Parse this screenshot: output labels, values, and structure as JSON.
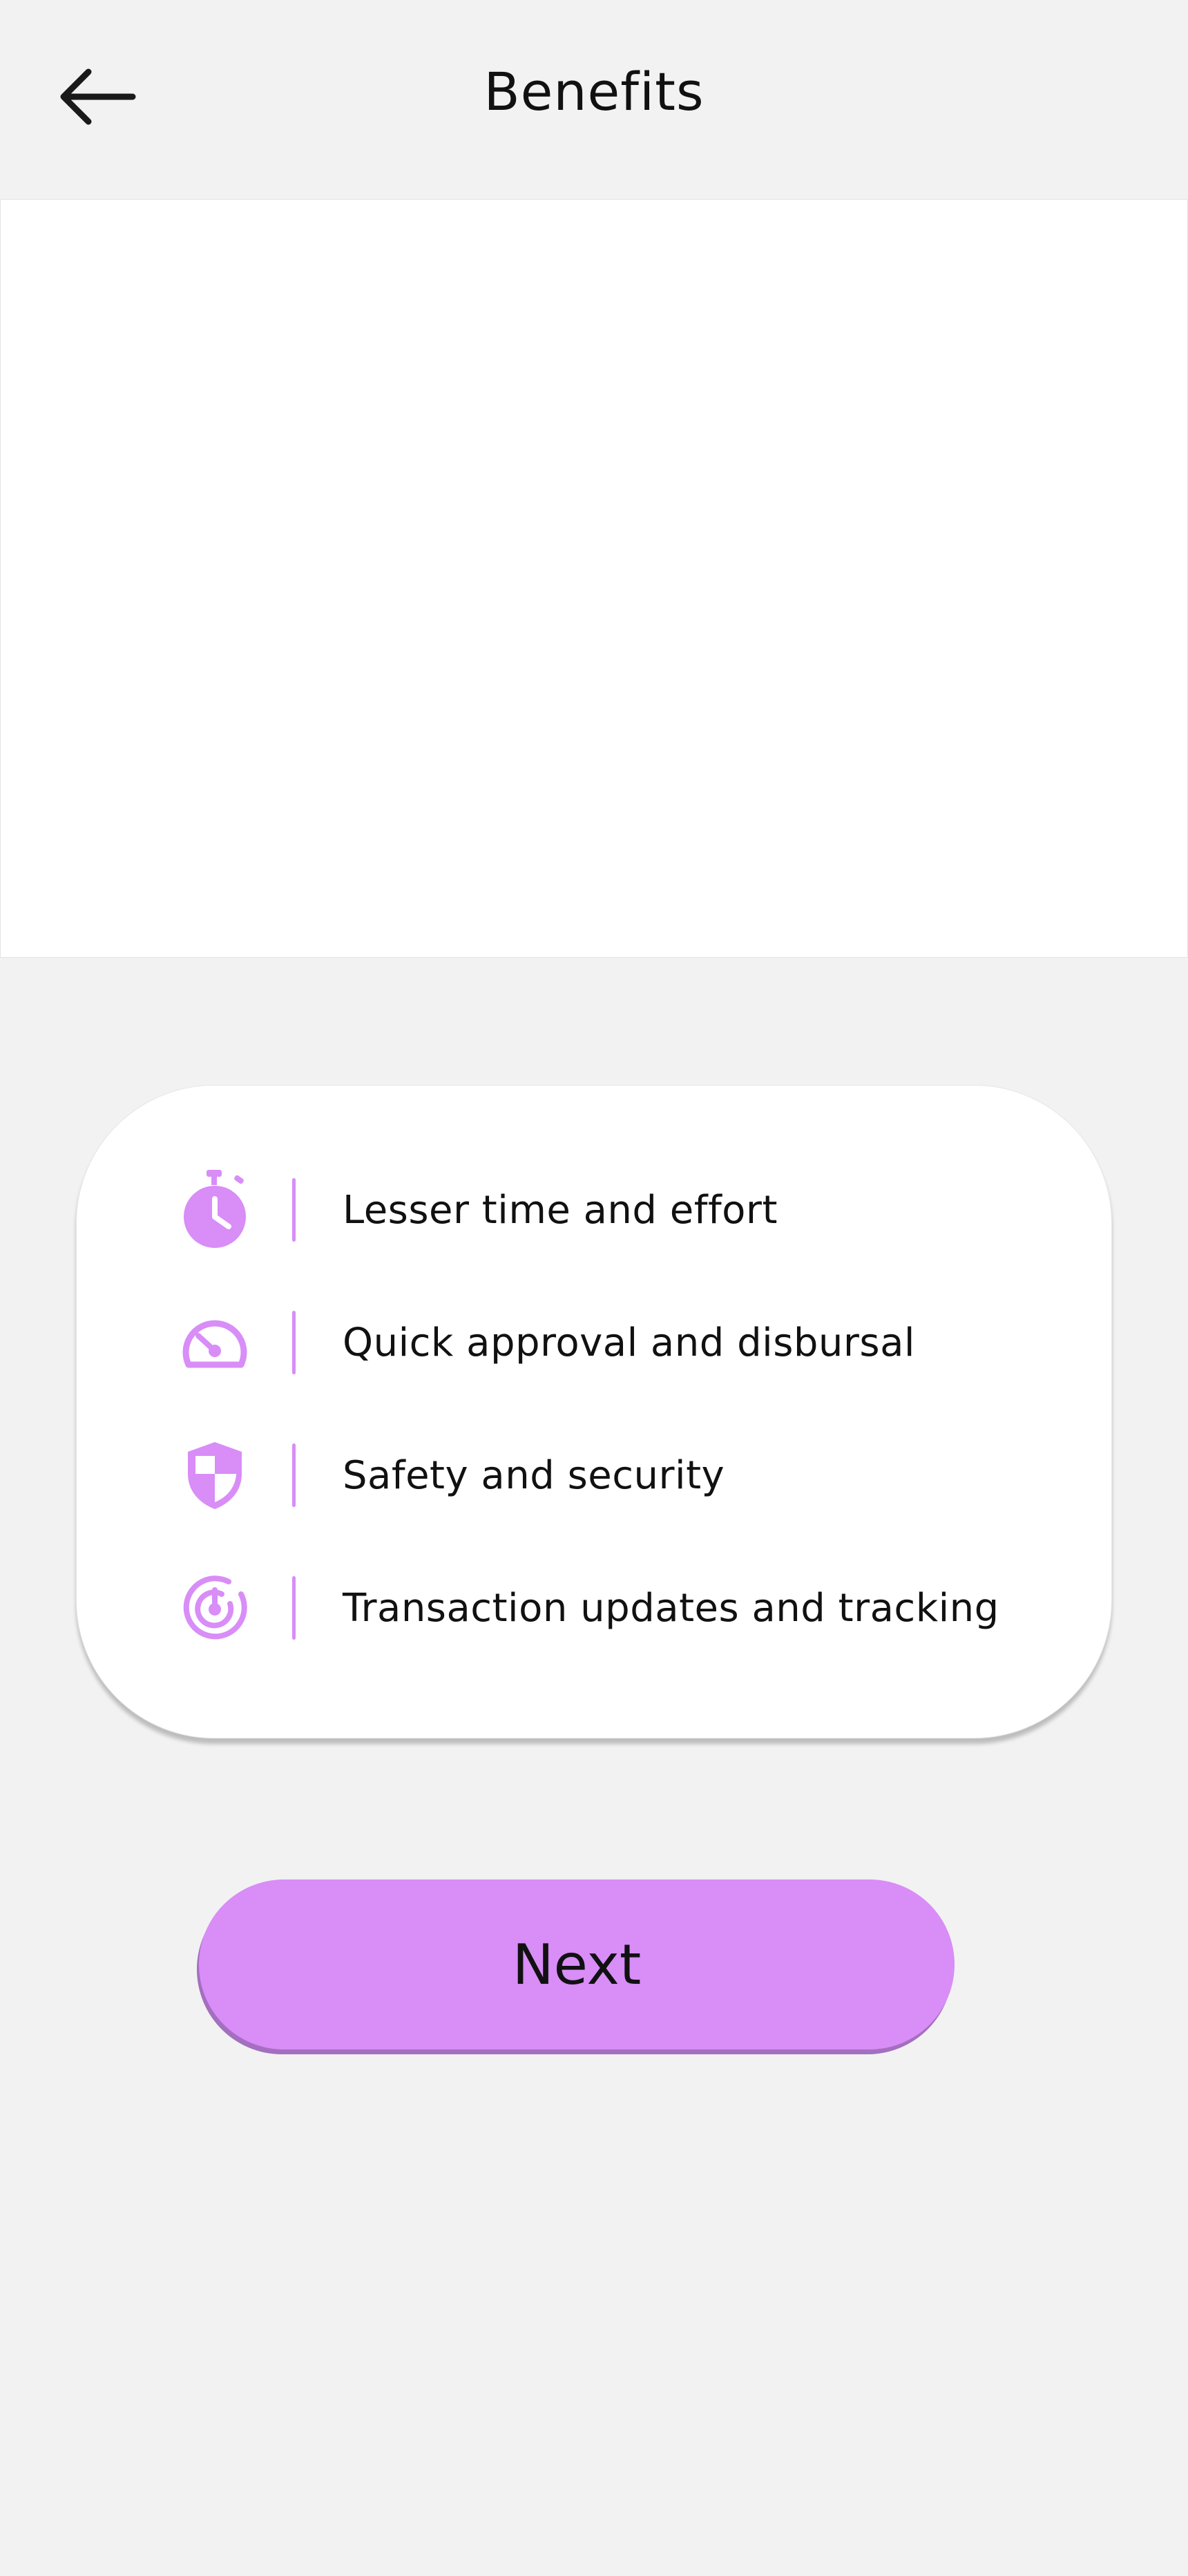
{
  "header": {
    "title": "Benefits",
    "back_icon": "arrow-left-icon"
  },
  "banner": {
    "background": "#ffffff"
  },
  "benefits": {
    "items": [
      {
        "label": "Lesser time and effort",
        "icon": "stopwatch-icon"
      },
      {
        "label": "Quick approval and disbursal",
        "icon": "speedometer-icon"
      },
      {
        "label": "Safety and security",
        "icon": "shield-icon"
      },
      {
        "label": "Transaction updates and tracking",
        "icon": "target-tracking-icon"
      }
    ]
  },
  "next_button": {
    "label": "Next"
  },
  "colors": {
    "accent": "#d88df7",
    "accent_shadow": "#a46fc0",
    "background": "#f2f2f2",
    "text": "#111111"
  }
}
